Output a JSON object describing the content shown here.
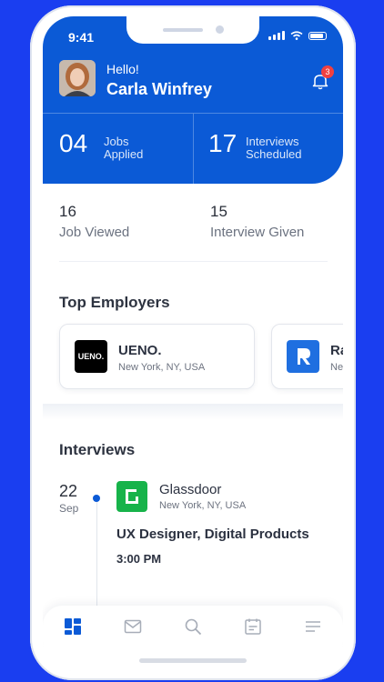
{
  "status_bar": {
    "time": "9:41"
  },
  "header": {
    "greeting": "Hello!",
    "user_name": "Carla Winfrey",
    "notification_count": "3"
  },
  "stats": [
    {
      "value": "04",
      "label_line1": "Jobs",
      "label_line2": "Applied"
    },
    {
      "value": "17",
      "label_line1": "Interviews",
      "label_line2": "Scheduled"
    }
  ],
  "sub_stats": [
    {
      "value": "16",
      "label": "Job Viewed"
    },
    {
      "value": "15",
      "label": "Interview Given"
    }
  ],
  "top_employers": {
    "title": "Top Employers",
    "items": [
      {
        "name": "UENO.",
        "location": "New York, NY, USA",
        "logo_text": "UENO."
      },
      {
        "name": "Ra",
        "location": "Ne"
      }
    ]
  },
  "interviews": {
    "title": "Interviews",
    "items": [
      {
        "day": "22",
        "month": "Sep",
        "company": "Glassdoor",
        "location": "New York, NY, USA",
        "role": "UX Designer, Digital Products",
        "time": "3:00 PM"
      }
    ]
  },
  "tabs": [
    {
      "icon": "dashboard-icon",
      "active": true
    },
    {
      "icon": "mail-icon",
      "active": false
    },
    {
      "icon": "search-icon",
      "active": false
    },
    {
      "icon": "calendar-icon",
      "active": false
    },
    {
      "icon": "menu-icon",
      "active": false
    }
  ],
  "colors": {
    "accent": "#0b5ad6",
    "background": "#1a3ef0",
    "badge": "#f04040",
    "glassdoor": "#17b34a"
  }
}
